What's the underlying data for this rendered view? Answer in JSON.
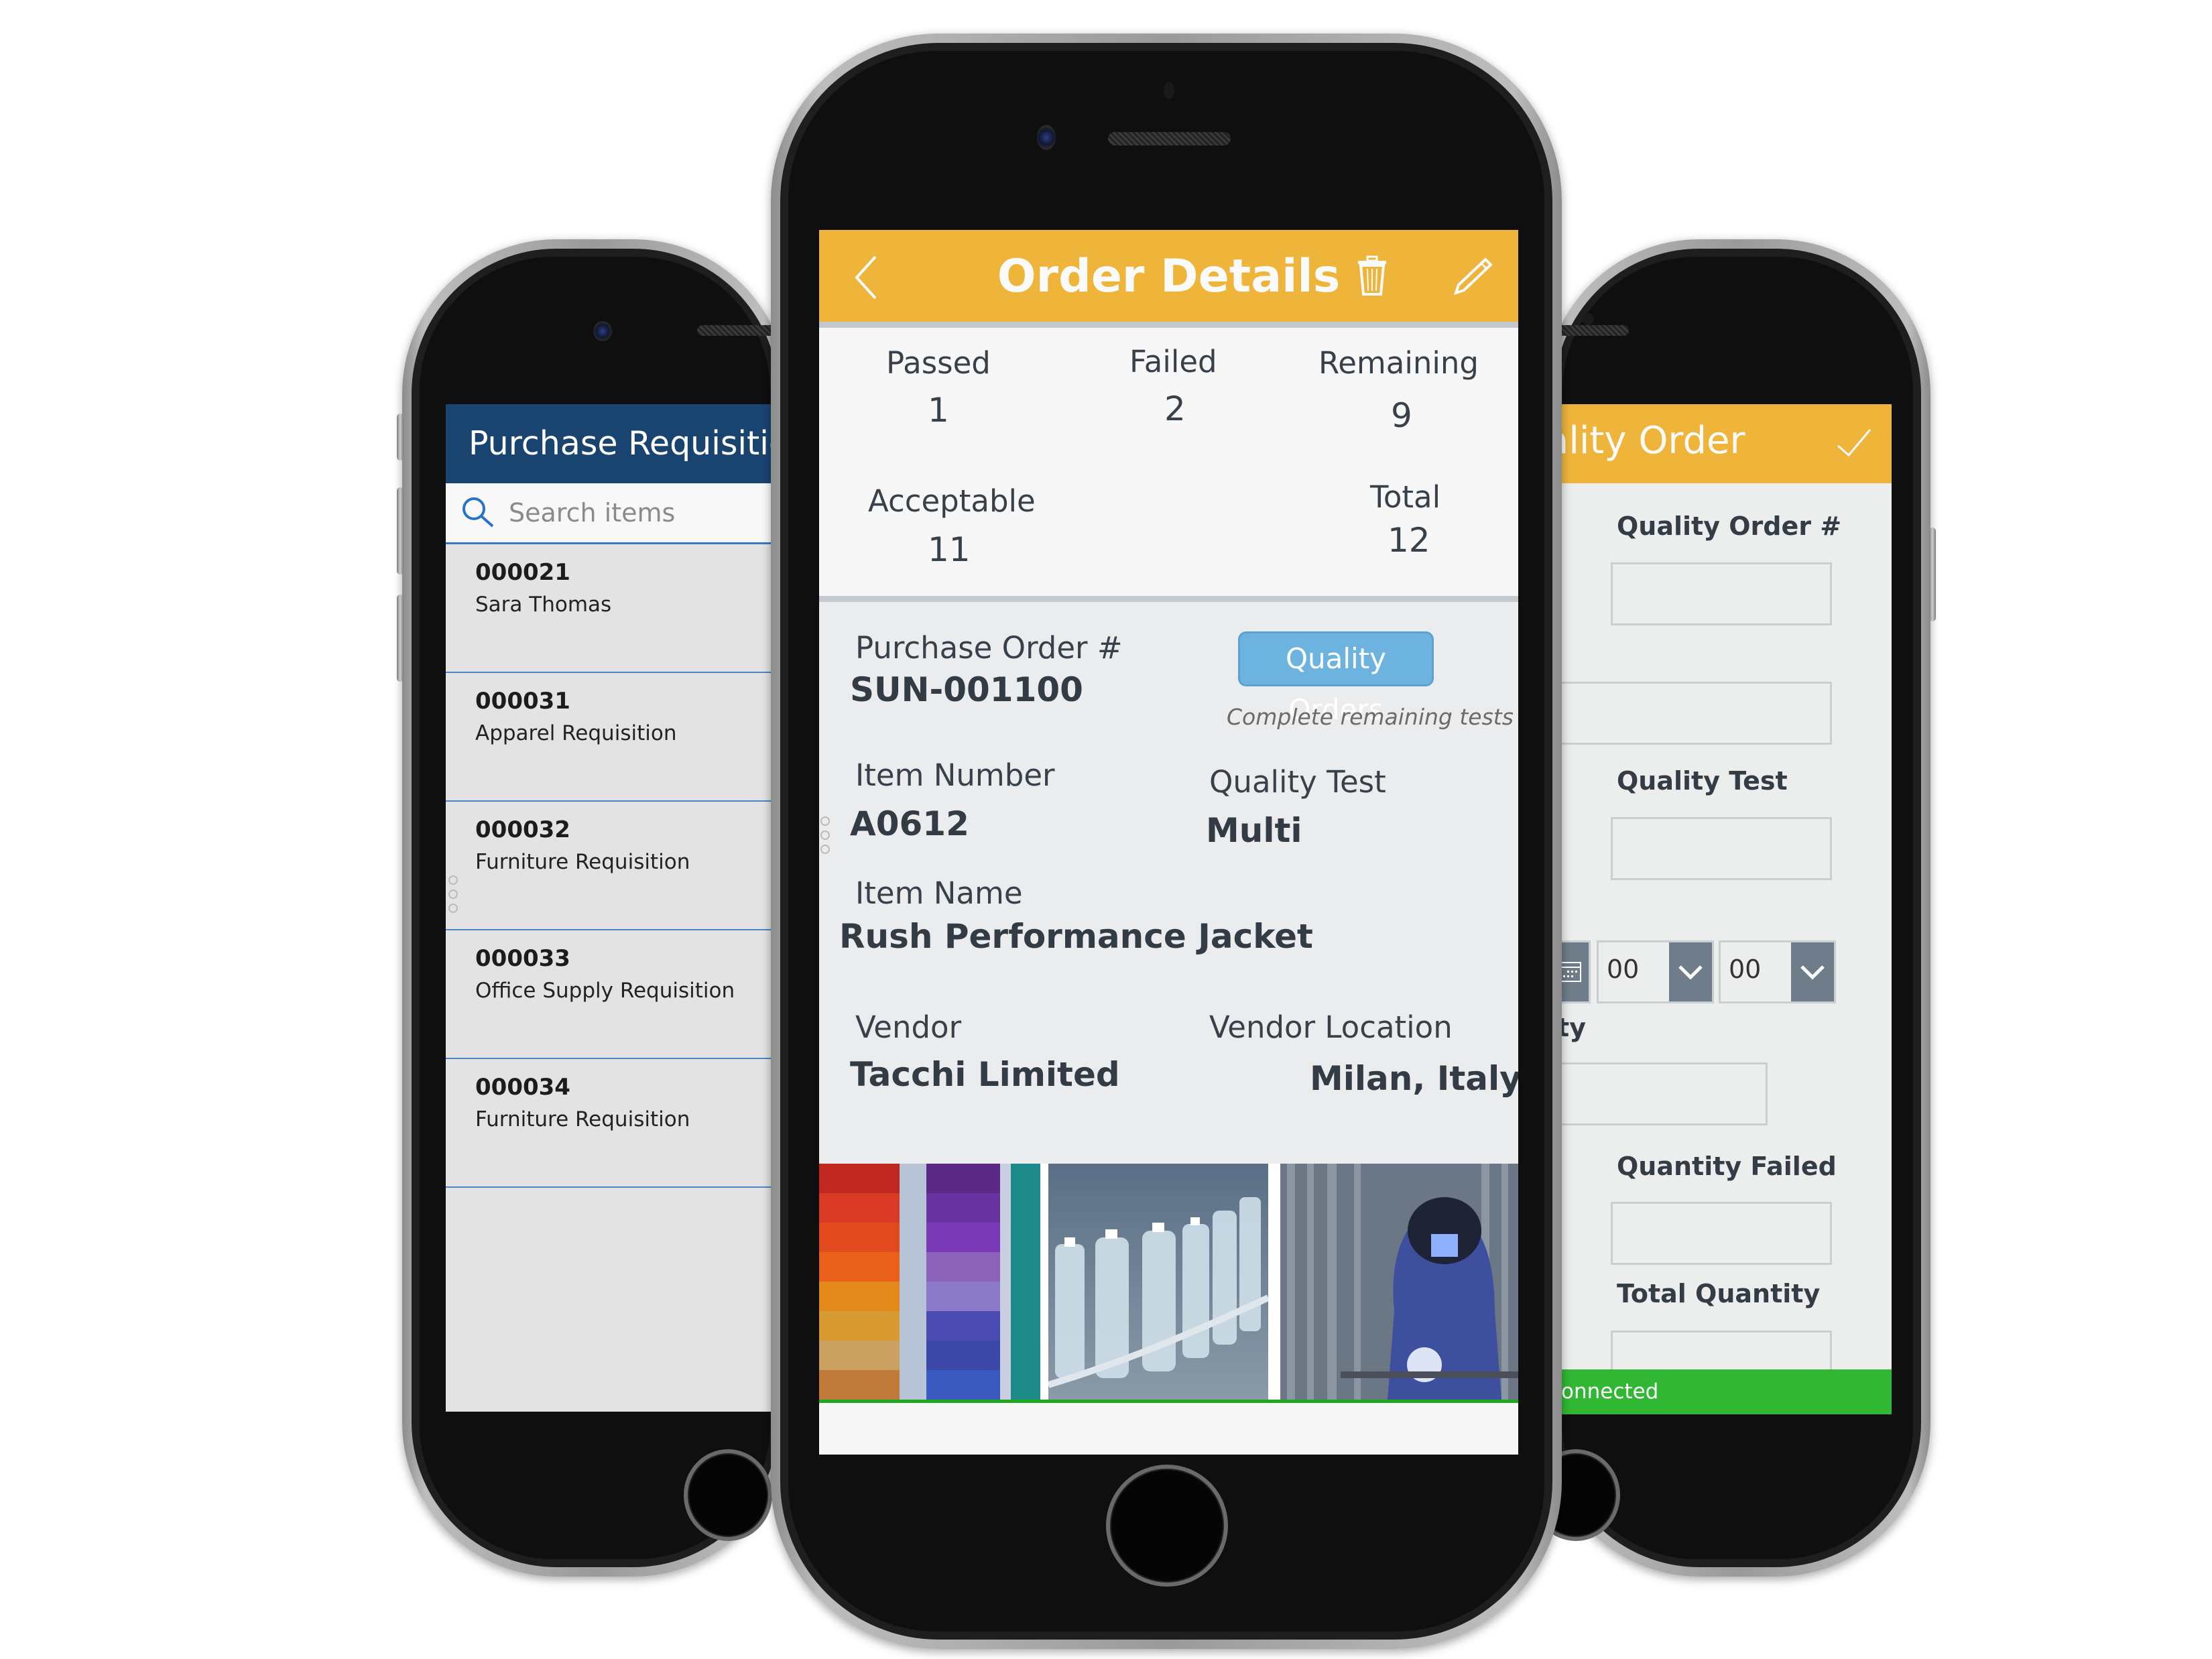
{
  "left_app": {
    "header_title": "Purchase Requisitio",
    "search": {
      "placeholder": "Search items",
      "value": ""
    },
    "items": [
      {
        "id": "000021",
        "name": "Sara Thomas"
      },
      {
        "id": "000031",
        "name": "Apparel Requisition"
      },
      {
        "id": "000032",
        "name": "Furniture Requisition"
      },
      {
        "id": "000033",
        "name": "Office Supply Requisition"
      },
      {
        "id": "000034",
        "name": "Furniture Requisition"
      }
    ]
  },
  "center_app": {
    "header": {
      "title": "Order Details",
      "back_icon": "chevron-left-icon",
      "delete_icon": "trash-icon",
      "edit_icon": "pencil-icon"
    },
    "stats": {
      "passed": {
        "label": "Passed",
        "value": "1"
      },
      "failed": {
        "label": "Failed",
        "value": "2"
      },
      "remaining": {
        "label": "Remaining",
        "value": "9"
      },
      "acceptable": {
        "label": "Acceptable",
        "value": "11"
      },
      "total": {
        "label": "Total",
        "value": "12"
      }
    },
    "details": {
      "purchase_order": {
        "label": "Purchase Order #",
        "value": "SUN-001100"
      },
      "quality_orders_button": "Quality Orders",
      "quality_orders_hint": "Complete remaining tests",
      "item_number": {
        "label": "Item Number",
        "value": "A0612"
      },
      "quality_test": {
        "label": "Quality Test",
        "value": "Multi"
      },
      "item_name": {
        "label": "Item Name",
        "value": "Rush Performance Jacket"
      },
      "vendor": {
        "label": "Vendor",
        "value": "Tacchi Limited"
      },
      "vendor_location": {
        "label": "Vendor Location",
        "value": "Milan, Italy"
      }
    },
    "images": [
      {
        "name": "thread-spools-photo"
      },
      {
        "name": "bottling-line-photo"
      },
      {
        "name": "welder-photo"
      }
    ],
    "colors": {
      "header": "#efb53b",
      "button": "#6cb4df",
      "accent_line": "#1ea81e"
    }
  },
  "right_app": {
    "header_title": "ality Order",
    "header_confirm_icon": "checkmark-icon",
    "labels": {
      "quality_order_no": "Quality Order #",
      "quality_test": "Quality Test",
      "quantity_partial": "ity",
      "quantity_failed": "Quantity Failed",
      "total_quantity": "Total Quantity"
    },
    "time": {
      "hour": "00",
      "minute": "00"
    },
    "status_text": "connected",
    "colors": {
      "header": "#efb53b",
      "status": "#31b733",
      "dropdown": "#6e7d89"
    }
  }
}
